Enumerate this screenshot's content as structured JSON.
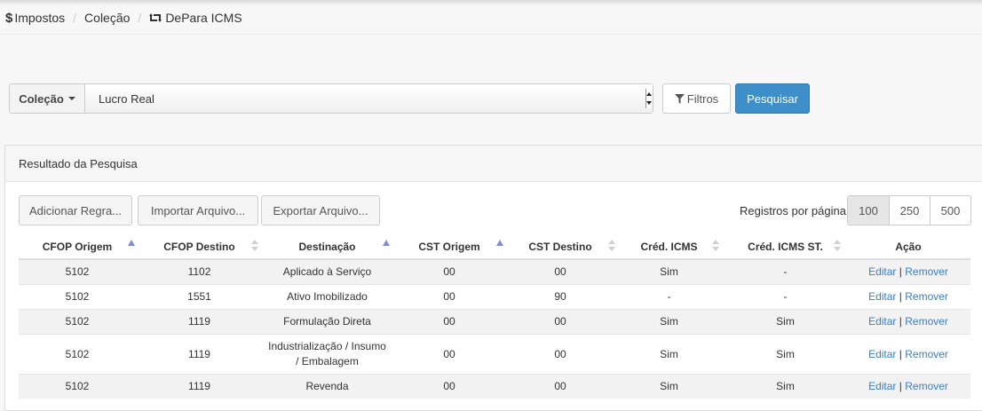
{
  "breadcrumb": {
    "items": [
      "Impostos",
      "Coleção",
      "DePara ICMS"
    ],
    "separator": "/"
  },
  "search": {
    "collection_label": "Coleção",
    "collection_value": "Lucro Real",
    "filters_label": "Filtros",
    "search_label": "Pesquisar"
  },
  "results": {
    "title": "Resultado da Pesquisa",
    "add_label": "Adicionar Regra...",
    "import_label": "Importar Arquivo...",
    "export_label": "Exportar Arquivo...",
    "per_page_label": "Registros por página",
    "per_page_options": [
      "100",
      "250",
      "500"
    ],
    "per_page_selected": "100",
    "columns": [
      "CFOP Origem",
      "CFOP Destino",
      "Destinação",
      "CST Origem",
      "CST Destino",
      "Créd. ICMS",
      "Créd. ICMS ST.",
      "Ação"
    ],
    "edit_label": "Editar",
    "remove_label": "Remover",
    "action_separator": "|",
    "rows": [
      {
        "cfop_origem": "5102",
        "cfop_destino": "1102",
        "destinacao": "Aplicado à Serviço",
        "cst_origem": "00",
        "cst_destino": "00",
        "cred_icms": "Sim",
        "cred_icms_st": "-"
      },
      {
        "cfop_origem": "5102",
        "cfop_destino": "1551",
        "destinacao": "Ativo Imobilizado",
        "cst_origem": "00",
        "cst_destino": "90",
        "cred_icms": "-",
        "cred_icms_st": "-"
      },
      {
        "cfop_origem": "5102",
        "cfop_destino": "1119",
        "destinacao": "Formulação Direta",
        "cst_origem": "00",
        "cst_destino": "00",
        "cred_icms": "Sim",
        "cred_icms_st": "Sim"
      },
      {
        "cfop_origem": "5102",
        "cfop_destino": "1119",
        "destinacao": "Industrialização / Insumo / Embalagem",
        "cst_origem": "00",
        "cst_destino": "00",
        "cred_icms": "Sim",
        "cred_icms_st": "Sim"
      },
      {
        "cfop_origem": "5102",
        "cfop_destino": "1119",
        "destinacao": "Revenda",
        "cst_origem": "00",
        "cst_destino": "00",
        "cred_icms": "Sim",
        "cred_icms_st": "Sim"
      }
    ]
  },
  "colors": {
    "primary": "#3d8ec9",
    "link": "#3a7fc1",
    "sort_active": "#7b8fd0"
  },
  "icons": {
    "breadcrumb_root": "dollar-icon",
    "breadcrumb_current": "retweet-icon",
    "filters": "filter-icon"
  }
}
